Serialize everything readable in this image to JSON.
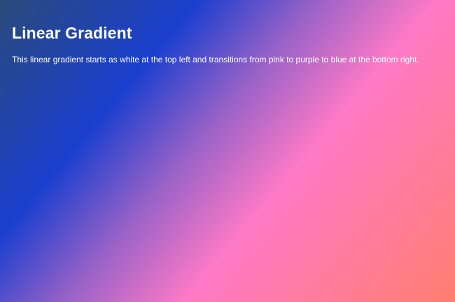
{
  "page": {
    "title": "Linear Gradient",
    "description": "This linear gradient starts as white at the top left and transitions from pink to purple to blue at the bottom right."
  },
  "colors": {
    "text": "#ffffff",
    "gradient_stops": [
      "#2a4a7a",
      "#1a3fcf",
      "#9a62c8",
      "#ff7ac6",
      "#ff7e6e"
    ]
  }
}
